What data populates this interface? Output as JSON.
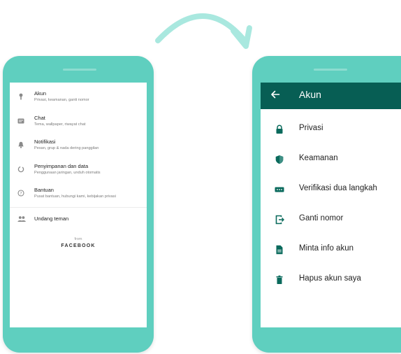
{
  "colors": {
    "phone": "#5fcfbf",
    "appbar": "#075e54",
    "icon_gray": "#8a8a8a",
    "icon_green": "#0a6a5c"
  },
  "settings": {
    "items": [
      {
        "icon": "key-icon",
        "title": "Akun",
        "subtitle": "Privasi, keamanan, ganti nomor"
      },
      {
        "icon": "chat-icon",
        "title": "Chat",
        "subtitle": "Tema, wallpaper, riwayat chat"
      },
      {
        "icon": "bell-icon",
        "title": "Notifikasi",
        "subtitle": "Pesan, grup & nada dering panggilan"
      },
      {
        "icon": "data-usage-icon",
        "title": "Penyimpanan dan data",
        "subtitle": "Penggunaan jaringan, unduh otomatis"
      },
      {
        "icon": "help-icon",
        "title": "Bantuan",
        "subtitle": "Pusat bantuan, hubungi kami, kebijakan privasi"
      }
    ],
    "invite": {
      "icon": "people-icon",
      "label": "Undang teman"
    },
    "from_label": "from",
    "brand": "FACEBOOK"
  },
  "account": {
    "title": "Akun",
    "items": [
      {
        "icon": "lock-icon",
        "label": "Privasi"
      },
      {
        "icon": "shield-icon",
        "label": "Keamanan"
      },
      {
        "icon": "dots-icon",
        "label": "Verifikasi dua langkah"
      },
      {
        "icon": "change-number-icon",
        "label": "Ganti nomor"
      },
      {
        "icon": "document-icon",
        "label": "Minta info akun"
      },
      {
        "icon": "trash-icon",
        "label": "Hapus akun saya"
      }
    ]
  }
}
